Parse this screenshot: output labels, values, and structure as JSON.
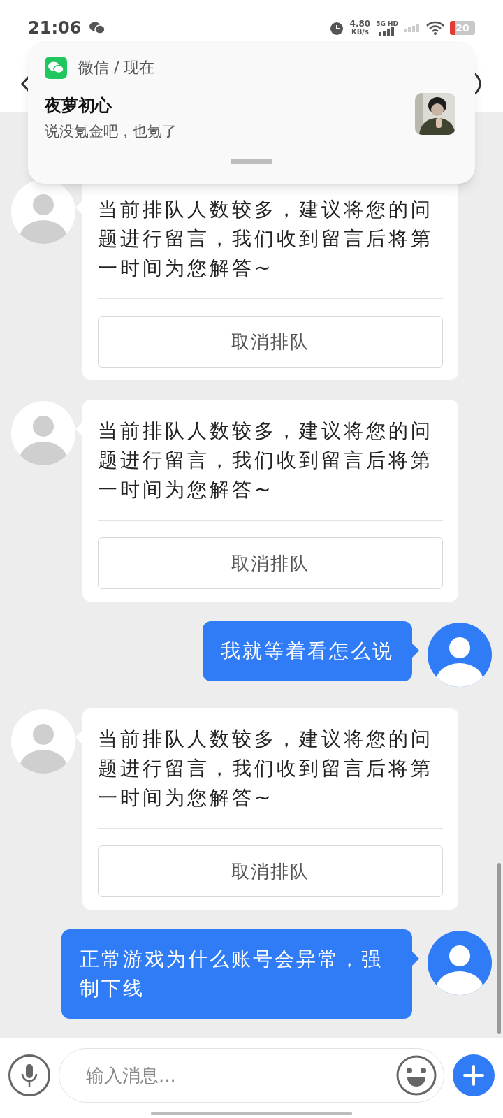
{
  "status_bar": {
    "time": "21:06",
    "speed": "4.80",
    "speed_unit": "KB/s",
    "network": "5G HD",
    "battery": "20"
  },
  "notification": {
    "app": "微信 / 现在",
    "title": "夜萝初心",
    "body": "说没氪金吧，也氪了"
  },
  "messages": [
    {
      "kind": "bot",
      "text": "当前排队人数较多，建议将您的问题进行留言，我们收到留言后将第一时间为您解答~",
      "button": "取消排队"
    },
    {
      "kind": "bot",
      "text": "当前排队人数较多，建议将您的问题进行留言，我们收到留言后将第一时间为您解答~",
      "button": "取消排队"
    },
    {
      "kind": "user",
      "text": "我就等着看怎么说"
    },
    {
      "kind": "bot",
      "text": "当前排队人数较多，建议将您的问题进行留言，我们收到留言后将第一时间为您解答~",
      "button": "取消排队"
    },
    {
      "kind": "user",
      "text": "正常游戏为什么账号会异常，强制下线"
    }
  ],
  "input": {
    "placeholder": "输入消息..."
  }
}
